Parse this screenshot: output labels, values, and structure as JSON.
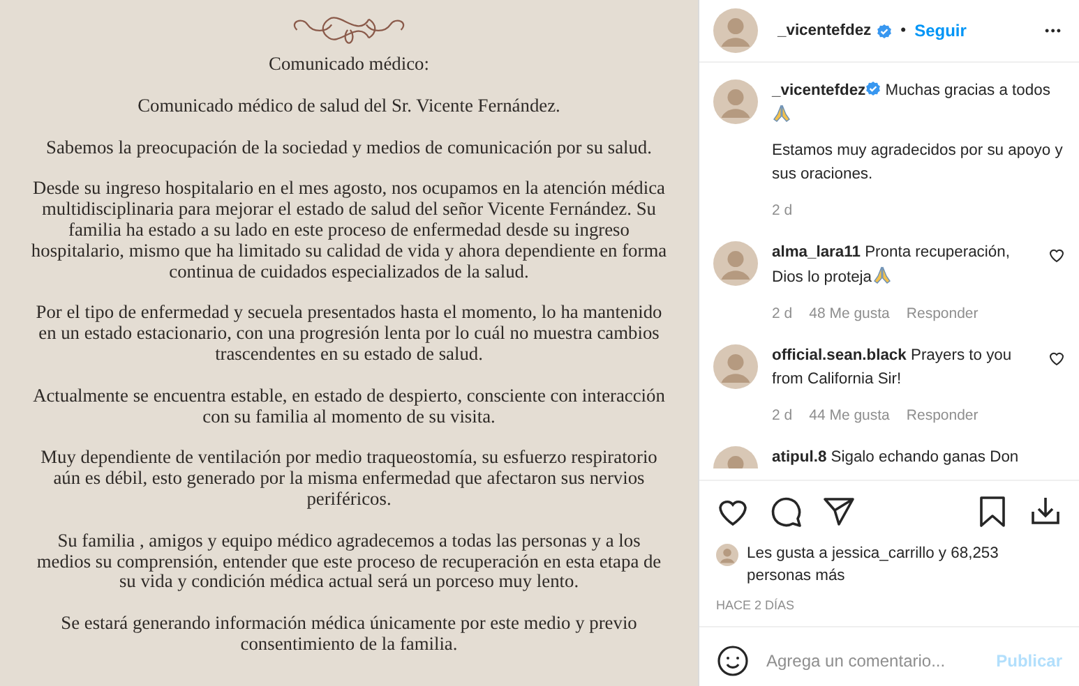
{
  "document": {
    "title": "Comunicado médico:",
    "paragraphs": [
      "Comunicado médico de salud del Sr. Vicente Fernández.",
      "Sabemos la preocupación de la sociedad y medios de comunicación por su salud.",
      "Desde su ingreso hospitalario en el mes agosto, nos ocupamos en la atención médica multidisciplinaria para mejorar el estado de salud del señor Vicente Fernández. Su familia ha estado a su lado en este proceso de enfermedad desde su ingreso hospitalario, mismo que ha limitado su calidad de vida y ahora dependiente en forma continua de cuidados especializados de la salud.",
      "Por el tipo de enfermedad y secuela presentados hasta el momento, lo ha mantenido en un estado estacionario, con una progresión lenta por lo cuál no muestra cambios trascendentes en su estado de salud.",
      "Actualmente se encuentra estable, en estado de despierto, consciente con interacción con su familia al momento de su visita.",
      "Muy dependiente de ventilación por medio traqueostomía, su esfuerzo respiratorio aún es débil, esto generado por la misma enfermedad que afectaron sus nervios periféricos.",
      "Su familia , amigos y equipo médico agradecemos a todas las personas y a los medios su comprensión, entender que este proceso de recuperación en esta etapa de su vida y condición médica actual será un porceso muy lento.",
      "Se estará generando información médica únicamente por este medio y previo consentimiento de la familia."
    ]
  },
  "header": {
    "username": "_vicentefdez",
    "verified": true,
    "separator": "•",
    "follow": "Seguir",
    "more": "•••"
  },
  "caption": {
    "username": "_vicentefdez",
    "verified": true,
    "text": "Muchas gracias a todos",
    "emoji": true,
    "text2": "Estamos muy agradecidos por su apoyo y sus oraciones.",
    "time": "2 d"
  },
  "comments": [
    {
      "username": "alma_lara11",
      "text": "Pronta recuperación, Dios lo proteja",
      "emoji": true,
      "time": "2 d",
      "likes": "48 Me gusta",
      "reply": "Responder",
      "liked": false
    },
    {
      "username": "official.sean.black",
      "text": "Prayers to you from California Sir!",
      "emoji": false,
      "time": "2 d",
      "likes": "44 Me gusta",
      "reply": "Responder",
      "liked": false
    },
    {
      "username": "atipul.8",
      "text": "Sigalo echando ganas Don",
      "emoji": false
    }
  ],
  "likes": {
    "prefix": "Les gusta a",
    "user": "jessica_carrillo",
    "suffix": "y",
    "count": "68,253 personas más"
  },
  "date": "HACE 2 DÍAS",
  "add_comment": {
    "placeholder": "Agrega un comentario...",
    "button": "Publicar"
  }
}
